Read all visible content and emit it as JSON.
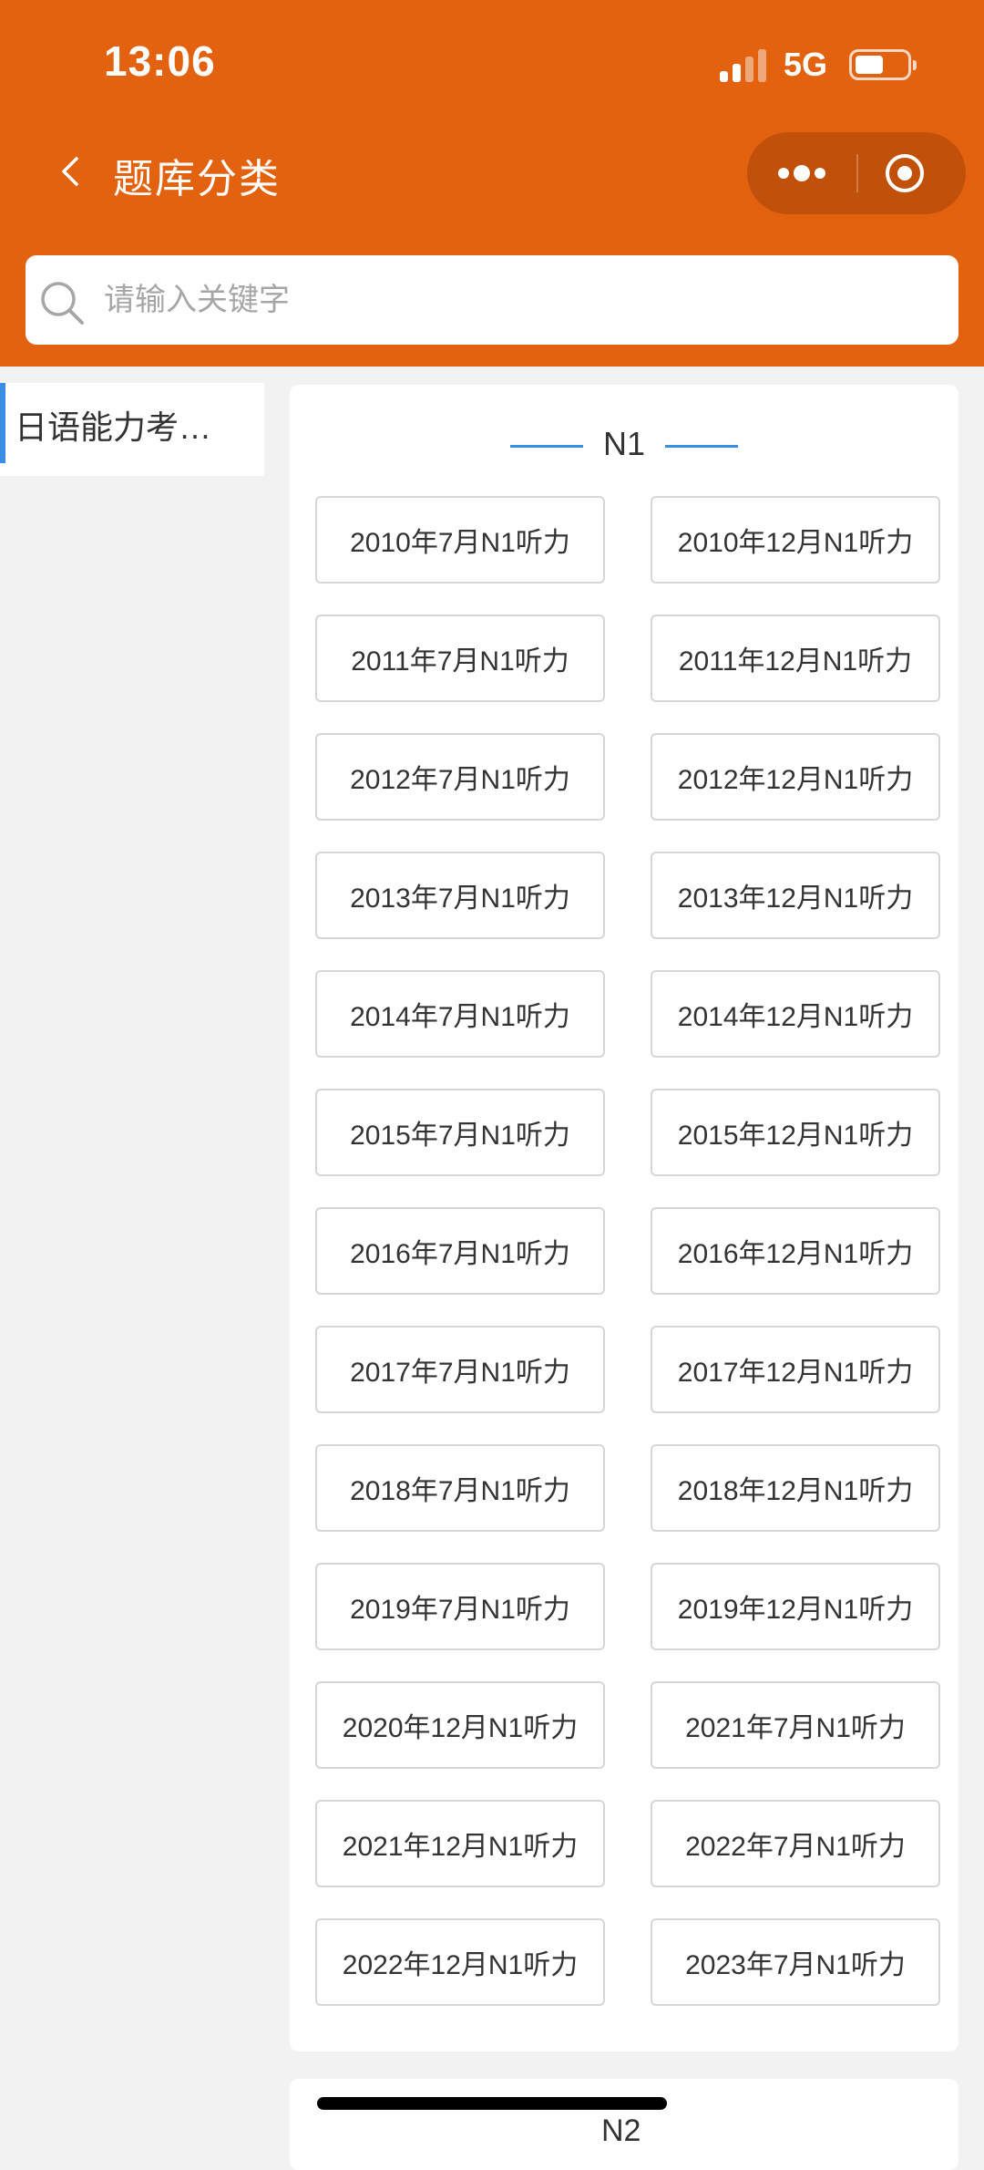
{
  "status_bar": {
    "time": "13:06",
    "network": "5G"
  },
  "nav": {
    "title": "题库分类",
    "back_icon": "chevron-left-icon",
    "more_icon": "more-dots-icon",
    "close_icon": "target-icon"
  },
  "search": {
    "placeholder": "请输入关键字",
    "icon": "search-icon"
  },
  "sidebar": {
    "items": [
      {
        "label": "日语能力考…",
        "active": true
      }
    ]
  },
  "sections": [
    {
      "title": "N1",
      "items": [
        "2010年7月N1听力",
        "2010年12月N1听力",
        "2011年7月N1听力",
        "2011年12月N1听力",
        "2012年7月N1听力",
        "2012年12月N1听力",
        "2013年7月N1听力",
        "2013年12月N1听力",
        "2014年7月N1听力",
        "2014年12月N1听力",
        "2015年7月N1听力",
        "2015年12月N1听力",
        "2016年7月N1听力",
        "2016年12月N1听力",
        "2017年7月N1听力",
        "2017年12月N1听力",
        "2018年7月N1听力",
        "2018年12月N1听力",
        "2019年7月N1听力",
        "2019年12月N1听力",
        "2020年12月N1听力",
        "2021年7月N1听力",
        "2021年12月N1听力",
        "2022年7月N1听力",
        "2022年12月N1听力",
        "2023年7月N1听力"
      ]
    },
    {
      "title": "N2"
    }
  ],
  "colors": {
    "header": "#e26210",
    "accent": "#3a8fe4",
    "background": "#f2f2f2"
  }
}
